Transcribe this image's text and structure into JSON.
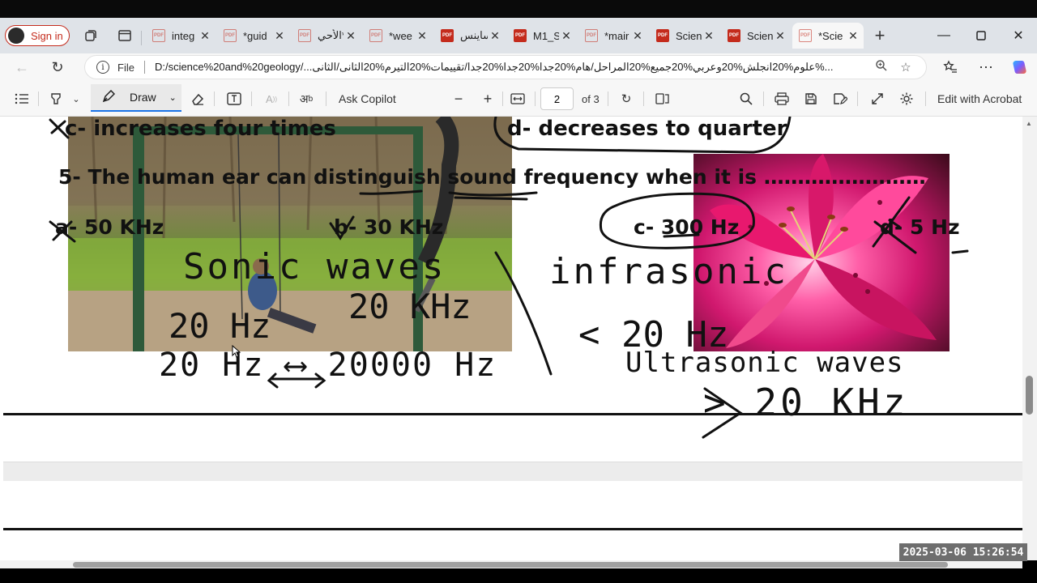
{
  "browser": {
    "signin_label": "Sign in",
    "tabs": [
      {
        "label": "integ",
        "icon": "pdf-icon"
      },
      {
        "label": "*guid",
        "icon": "pdf-icon"
      },
      {
        "label": "الأحي*",
        "icon": "pdf-icon"
      },
      {
        "label": "*wee",
        "icon": "pdf-icon"
      },
      {
        "label": "ساينس",
        "icon": "pdf-icon"
      },
      {
        "label": "M1_S",
        "icon": "pdf-icon"
      },
      {
        "label": "*mair",
        "icon": "pdf-icon"
      },
      {
        "label": "Scien",
        "icon": "pdf-icon"
      },
      {
        "label": "Scien",
        "icon": "pdf-icon"
      },
      {
        "label": "*Scie",
        "icon": "pdf-icon",
        "active": true
      }
    ],
    "new_tab": "+",
    "address": {
      "scheme_label": "File",
      "url": "D:/science%20and%20geology/...علوم%20انجلش%20وعربي%20جميع%20المراحل/هام%20جدا%20جدا%20جدا/تقييمات%20التيرم%20الثانى/الثانى%..."
    }
  },
  "pdf_toolbar": {
    "draw_label": "Draw",
    "ask_copilot": "Ask Copilot",
    "zoom_out": "−",
    "zoom_in": "+",
    "page_current": "2",
    "page_total": "of 3",
    "edit_acrobat": "Edit with Acrobat"
  },
  "document": {
    "line_c_option": "c- increases four times",
    "line_d_option": "d- decreases to quarter",
    "question5": "5- The human ear can distinguish sound frequency when it is ……………………",
    "q5_options": [
      "a- 50 KHz",
      "b- 30 KHz",
      "c- 300 Hz",
      "d- 5 Hz"
    ],
    "handwriting": {
      "sonic": "Sonic waves",
      "sonic_low": "20 Hz",
      "sonic_high": "20 KHz",
      "range": "20 Hz ⟷ 20000 Hz",
      "infrasonic": "infrasonic",
      "infra_value": "< 20 Hz",
      "ultrasonic": "Ultrasonic waves",
      "ultra_value": "> 20 KHz"
    }
  },
  "timestamp": "2025-03-06  15:26:54"
}
